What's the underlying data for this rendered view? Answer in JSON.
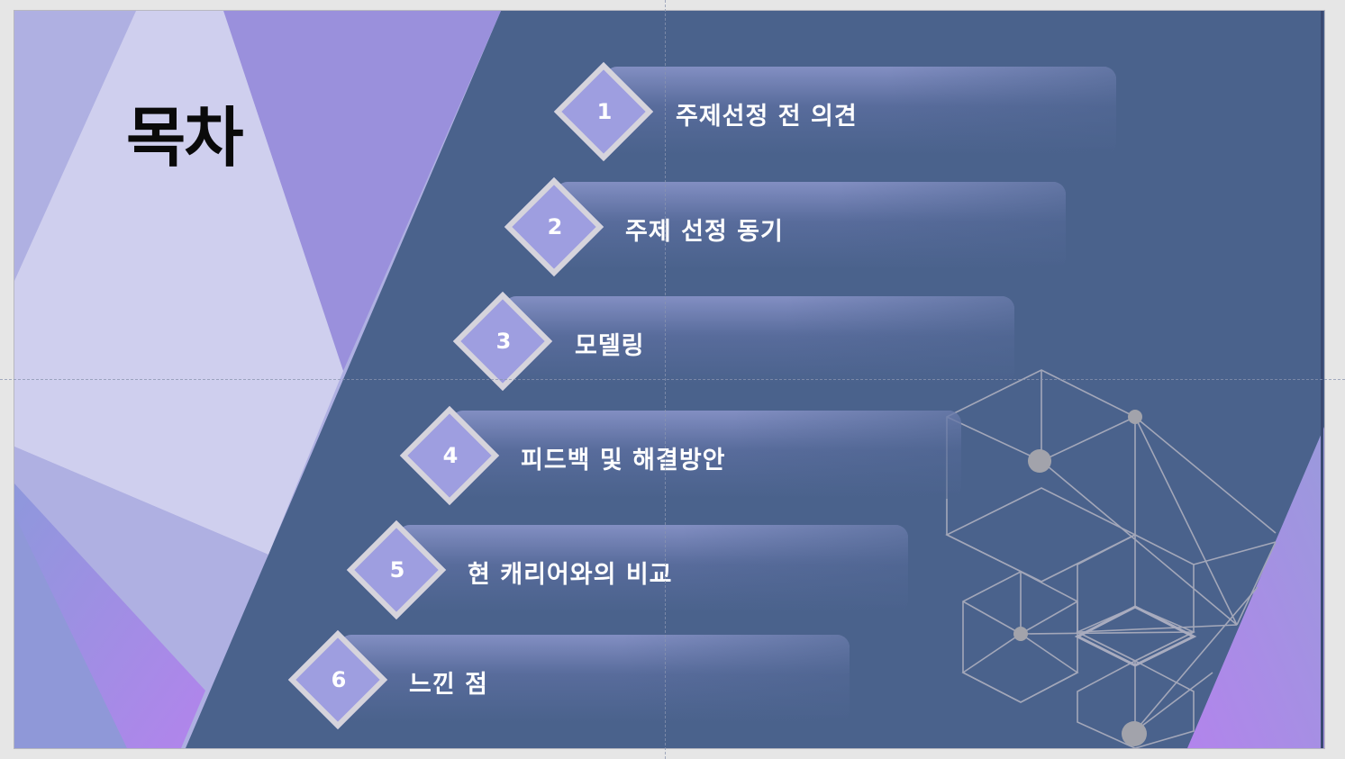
{
  "slide": {
    "title": "목차",
    "colors": {
      "background": "#4a628c",
      "lavender_light": "#cfcfee",
      "lavender_mid": "#afb0e2",
      "purple": "#9a90dc",
      "pink_purple": "#b284ec",
      "diamond_fill": "#9e9ee0",
      "diamond_border": "#d6d4dc",
      "text": "#ffffff",
      "title_text": "#0a0a0a"
    },
    "items": [
      {
        "number": "1",
        "label": "주제선정 전 의견"
      },
      {
        "number": "2",
        "label": "주제 선정 동기"
      },
      {
        "number": "3",
        "label": "모델링"
      },
      {
        "number": "4",
        "label": "피드백 및 해결방안"
      },
      {
        "number": "5",
        "label": "현 캐리어와의 비교"
      },
      {
        "number": "6",
        "label": "느낀 점"
      }
    ],
    "decoration": {
      "type": "network-hexagons-icon"
    }
  }
}
